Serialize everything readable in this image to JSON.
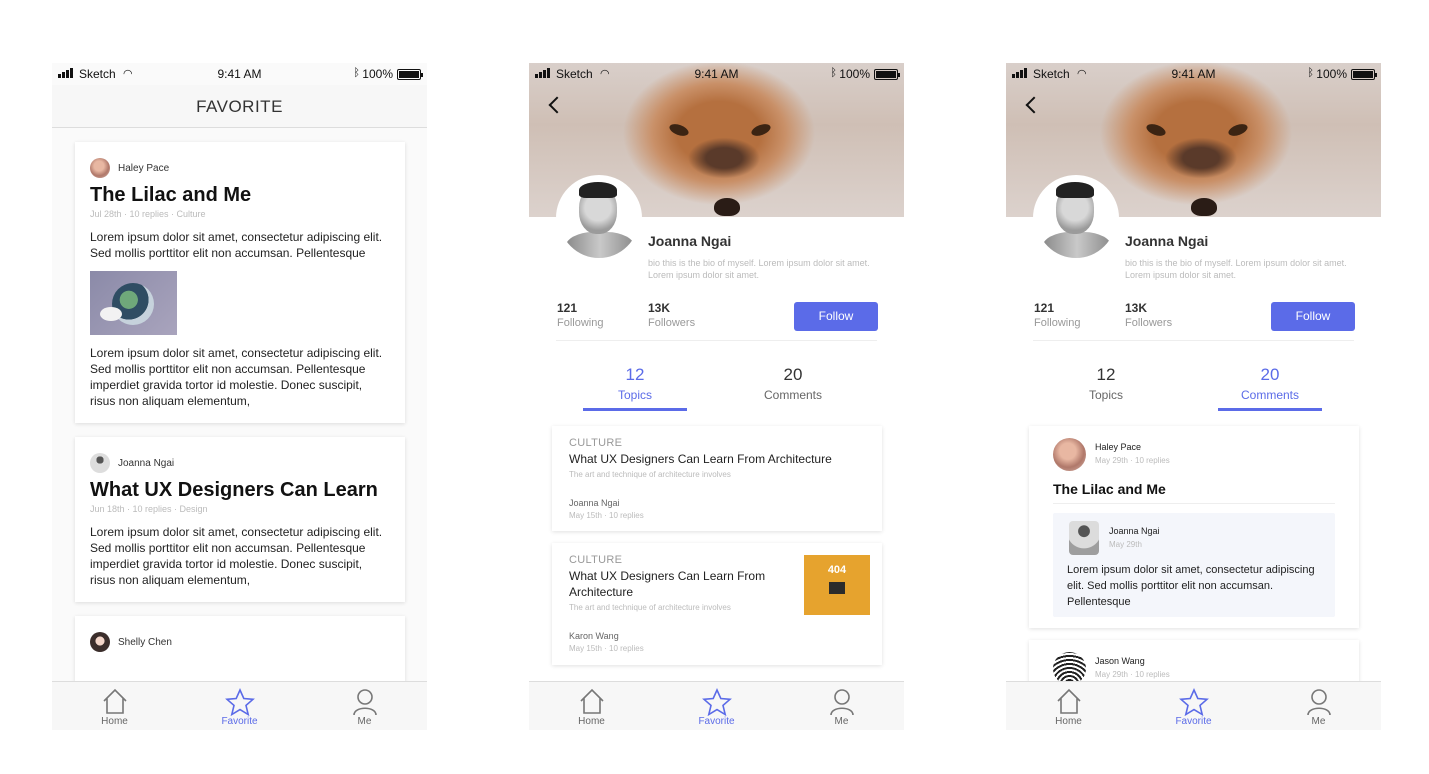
{
  "status": {
    "carrier": "Sketch",
    "time": "9:41 AM",
    "battery": "100%"
  },
  "tabs": {
    "home": "Home",
    "favorite": "Favorite",
    "me": "Me"
  },
  "colors": {
    "accent": "#5b6be8"
  },
  "favorite_screen": {
    "nav_title": "FAVORITE",
    "posts": [
      {
        "author": "Haley Pace",
        "title": "The Lilac and Me",
        "meta": "Jul 28th · 10 replies · Culture",
        "body1": "Lorem ipsum dolor sit amet, consectetur adipiscing elit. Sed mollis porttitor elit non accumsan. Pellentesque",
        "body2": "Lorem ipsum dolor sit amet, consectetur adipiscing elit. Sed mollis porttitor elit non accumsan. Pellentesque imperdiet gravida tortor id molestie. Donec suscipit, risus non aliquam elementum,"
      },
      {
        "author": "Joanna Ngai",
        "title": "What UX Designers Can Learn",
        "meta": "Jun 18th · 10 replies · Design",
        "body1": "Lorem ipsum dolor sit amet, consectetur adipiscing elit. Sed mollis porttitor elit non accumsan. Pellentesque imperdiet gravida tortor id molestie. Donec suscipit, risus non aliquam elementum,"
      },
      {
        "author": "Shelly Chen"
      }
    ]
  },
  "profile": {
    "name": "Joanna Ngai",
    "bio": "bio this is the bio of myself. Lorem ipsum dolor sit amet. Lorem ipsum dolor sit amet.",
    "following_count": "121",
    "following_label": "Following",
    "followers_count": "13K",
    "followers_label": "Followers",
    "follow_button": "Follow",
    "topics_count": "12",
    "topics_label": "Topics",
    "comments_count": "20",
    "comments_label": "Comments"
  },
  "topics": [
    {
      "category": "CULTURE",
      "title": "What UX Designers Can Learn From Architecture",
      "subtitle": "The art and technique of architecture involves",
      "author": "Joanna Ngai",
      "meta": "May 15th · 10 replies"
    },
    {
      "category": "CULTURE",
      "title": "What UX Designers Can Learn From Architecture",
      "subtitle": "The art and technique of architecture involves",
      "author": "Karon Wang",
      "meta": "May 15th · 10 replies",
      "image_text": "404"
    }
  ],
  "comments": [
    {
      "author": "Haley Pace",
      "meta": "May 29th · 10 replies",
      "title": "The Lilac and Me",
      "reply_author": "Joanna Ngai",
      "reply_meta": "May 29th",
      "reply_text": "Lorem ipsum dolor sit amet, consectetur adipiscing elit. Sed mollis porttitor elit non accumsan. Pellentesque"
    },
    {
      "author": "Jason Wang",
      "meta": "May 29th · 10 replies"
    }
  ]
}
